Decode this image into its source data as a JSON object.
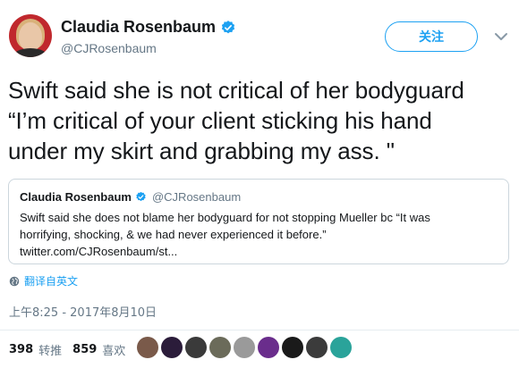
{
  "author": {
    "name": "Claudia Rosenbaum",
    "handle": "@CJRosenbaum"
  },
  "follow_label": "关注",
  "tweet": {
    "lines": [
      "Swift said she is not critical of her bodyguard",
      "“I’m critical of your client sticking his hand",
      "under my skirt and grabbing my ass. \""
    ]
  },
  "quoted_tweet": {
    "name": "Claudia Rosenbaum",
    "handle": "@CJRosenbaum",
    "lines": [
      "Swift said she does not blame her bodyguard for not stopping Mueller bc “It was",
      "horrifying, shocking, & we had never experienced it before.”",
      "twitter.com/CJRosenbaum/st..."
    ]
  },
  "translate_label": "翻译自英文",
  "timestamp": "上午8:25 - 2017年8月10日",
  "stats": {
    "retweets_count": "398",
    "retweets_label": "转推",
    "likes_count": "859",
    "likes_label": "喜欢"
  },
  "likers": [
    {
      "color": "#7a5a4a"
    },
    {
      "color": "#2b1c3a"
    },
    {
      "color": "#3a3a3a"
    },
    {
      "color": "#6b6b5a"
    },
    {
      "color": "#9a9a9a"
    },
    {
      "color": "#6a2d8c"
    },
    {
      "color": "#1a1a1a"
    },
    {
      "color": "#3b3b3b"
    },
    {
      "color": "#2aa39a"
    }
  ],
  "colors": {
    "accent": "#1da1f2",
    "secondary_text": "#657786",
    "primary_text": "#14171a",
    "border": "#ccd6dd"
  },
  "icons": [
    "verified-badge-icon",
    "chevron-down-icon",
    "globe-icon"
  ]
}
